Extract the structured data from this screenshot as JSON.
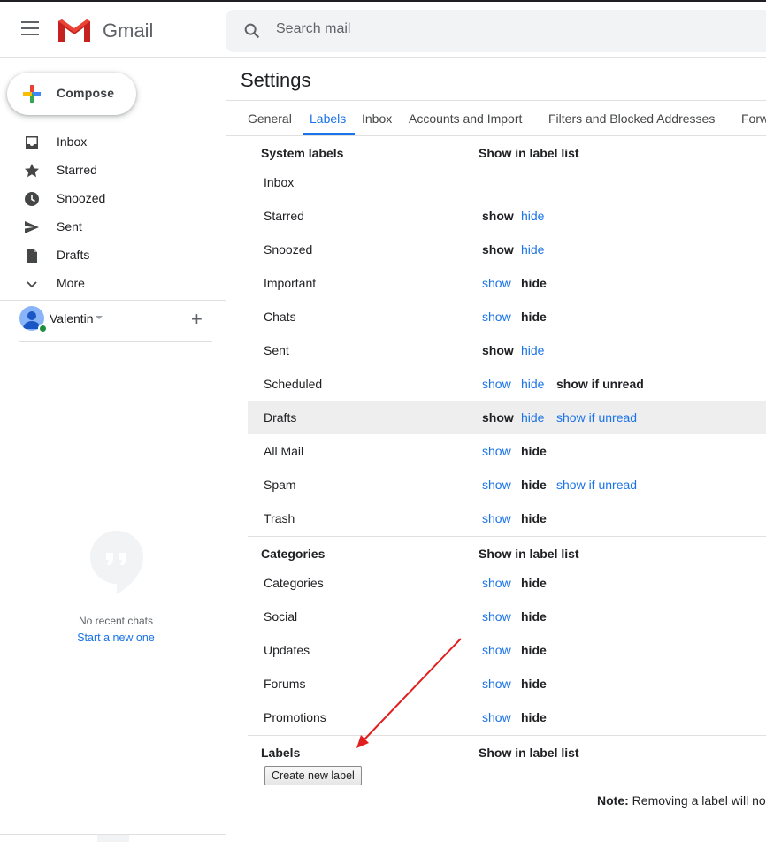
{
  "app": {
    "name": "Gmail"
  },
  "search": {
    "placeholder": "Search mail"
  },
  "compose": {
    "label": "Compose"
  },
  "nav": [
    {
      "label": "Inbox",
      "icon": "inbox-icon"
    },
    {
      "label": "Starred",
      "icon": "star-icon"
    },
    {
      "label": "Snoozed",
      "icon": "clock-icon"
    },
    {
      "label": "Sent",
      "icon": "send-icon"
    },
    {
      "label": "Drafts",
      "icon": "draft-icon"
    },
    {
      "label": "More",
      "icon": "chevron-down-icon"
    }
  ],
  "user": {
    "name": "Valentin"
  },
  "chats": {
    "empty": "No recent chats",
    "start": "Start a new one"
  },
  "settings": {
    "title": "Settings",
    "tabs": [
      "General",
      "Labels",
      "Inbox",
      "Accounts and Import",
      "Filters and Blocked Addresses",
      "Forw"
    ],
    "active_tab": "Labels"
  },
  "system_labels": {
    "heading": "System labels",
    "col_heading": "Show in label list",
    "rows": [
      {
        "name": "Inbox",
        "options": []
      },
      {
        "name": "Starred",
        "options": [
          [
            "show",
            "bold"
          ],
          [
            "hide",
            "link"
          ]
        ]
      },
      {
        "name": "Snoozed",
        "options": [
          [
            "show",
            "bold"
          ],
          [
            "hide",
            "link"
          ]
        ]
      },
      {
        "name": "Important",
        "options": [
          [
            "show",
            "link"
          ],
          [
            "hide",
            "bold"
          ]
        ]
      },
      {
        "name": "Chats",
        "options": [
          [
            "show",
            "link"
          ],
          [
            "hide",
            "bold"
          ]
        ]
      },
      {
        "name": "Sent",
        "options": [
          [
            "show",
            "bold"
          ],
          [
            "hide",
            "link"
          ]
        ]
      },
      {
        "name": "Scheduled",
        "options": [
          [
            "show",
            "link"
          ],
          [
            "hide",
            "link"
          ],
          [
            "show if unread",
            "bold"
          ]
        ]
      },
      {
        "name": "Drafts",
        "options": [
          [
            "show",
            "bold"
          ],
          [
            "hide",
            "link"
          ],
          [
            "show if unread",
            "link"
          ]
        ]
      },
      {
        "name": "All Mail",
        "options": [
          [
            "show",
            "link"
          ],
          [
            "hide",
            "bold"
          ]
        ]
      },
      {
        "name": "Spam",
        "options": [
          [
            "show",
            "link"
          ],
          [
            "hide",
            "bold"
          ],
          [
            "show if unread",
            "link"
          ]
        ]
      },
      {
        "name": "Trash",
        "options": [
          [
            "show",
            "link"
          ],
          [
            "hide",
            "bold"
          ]
        ]
      }
    ]
  },
  "categories": {
    "heading": "Categories",
    "col_heading": "Show in label list",
    "rows": [
      {
        "name": "Categories",
        "options": [
          [
            "show",
            "link"
          ],
          [
            "hide",
            "bold"
          ]
        ]
      },
      {
        "name": "Social",
        "options": [
          [
            "show",
            "link"
          ],
          [
            "hide",
            "bold"
          ]
        ]
      },
      {
        "name": "Updates",
        "options": [
          [
            "show",
            "link"
          ],
          [
            "hide",
            "bold"
          ]
        ]
      },
      {
        "name": "Forums",
        "options": [
          [
            "show",
            "link"
          ],
          [
            "hide",
            "bold"
          ]
        ]
      },
      {
        "name": "Promotions",
        "options": [
          [
            "show",
            "link"
          ],
          [
            "hide",
            "bold"
          ]
        ]
      }
    ]
  },
  "labels": {
    "heading": "Labels",
    "col_heading": "Show in label list",
    "create_button": "Create new label",
    "note_bold": "Note:",
    "note_text": " Removing a label will no"
  },
  "colors": {
    "accent": "#1a73e8",
    "arrow": "#e02020",
    "highlight": "#eeeeee"
  }
}
